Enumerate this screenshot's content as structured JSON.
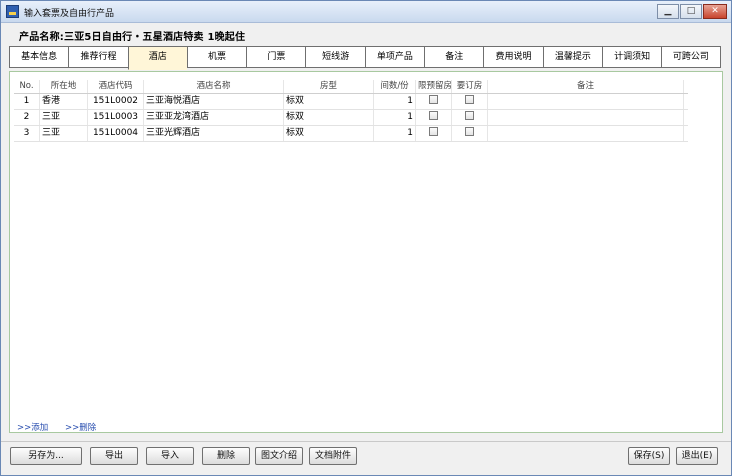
{
  "window": {
    "title": "输入套票及自由行产品"
  },
  "product": {
    "label": "产品名称:三亚5日自由行・五星酒店特卖 1晚起住"
  },
  "tabs": [
    {
      "label": "基本信息"
    },
    {
      "label": "推荐行程"
    },
    {
      "label": "酒店"
    },
    {
      "label": "机票"
    },
    {
      "label": "门票"
    },
    {
      "label": "短线游"
    },
    {
      "label": "单项产品"
    },
    {
      "label": "备注"
    },
    {
      "label": "费用说明"
    },
    {
      "label": "温馨提示"
    },
    {
      "label": "计调须知"
    },
    {
      "label": "可跨公司"
    }
  ],
  "active_tab": "酒店",
  "grid": {
    "headers": [
      "No.",
      "所在地",
      "酒店代码",
      "酒店名称",
      "房型",
      "间数/份",
      "限预留房",
      "要订房",
      "备注"
    ],
    "rows": [
      {
        "no": "1",
        "loc": "香港",
        "code": "151L0002",
        "name": "三亚海悦酒店",
        "room": "标双",
        "count": "1",
        "memo": ""
      },
      {
        "no": "2",
        "loc": "三亚",
        "code": "151L0003",
        "name": "三亚亚龙湾酒店",
        "room": "标双",
        "count": "1",
        "memo": ""
      },
      {
        "no": "3",
        "loc": "三亚",
        "code": "151L0004",
        "name": "三亚光辉酒店",
        "room": "标双",
        "count": "1",
        "memo": ""
      }
    ]
  },
  "links": {
    "add": ">>添加",
    "delete": ">>删除"
  },
  "buttons": {
    "save_as": "另存为...",
    "export": "导出",
    "import": "导入",
    "delete": "删除",
    "illustrated": "图文介绍",
    "attachments": "文档附件",
    "save": "保存(S)",
    "exit": "退出(E)"
  }
}
